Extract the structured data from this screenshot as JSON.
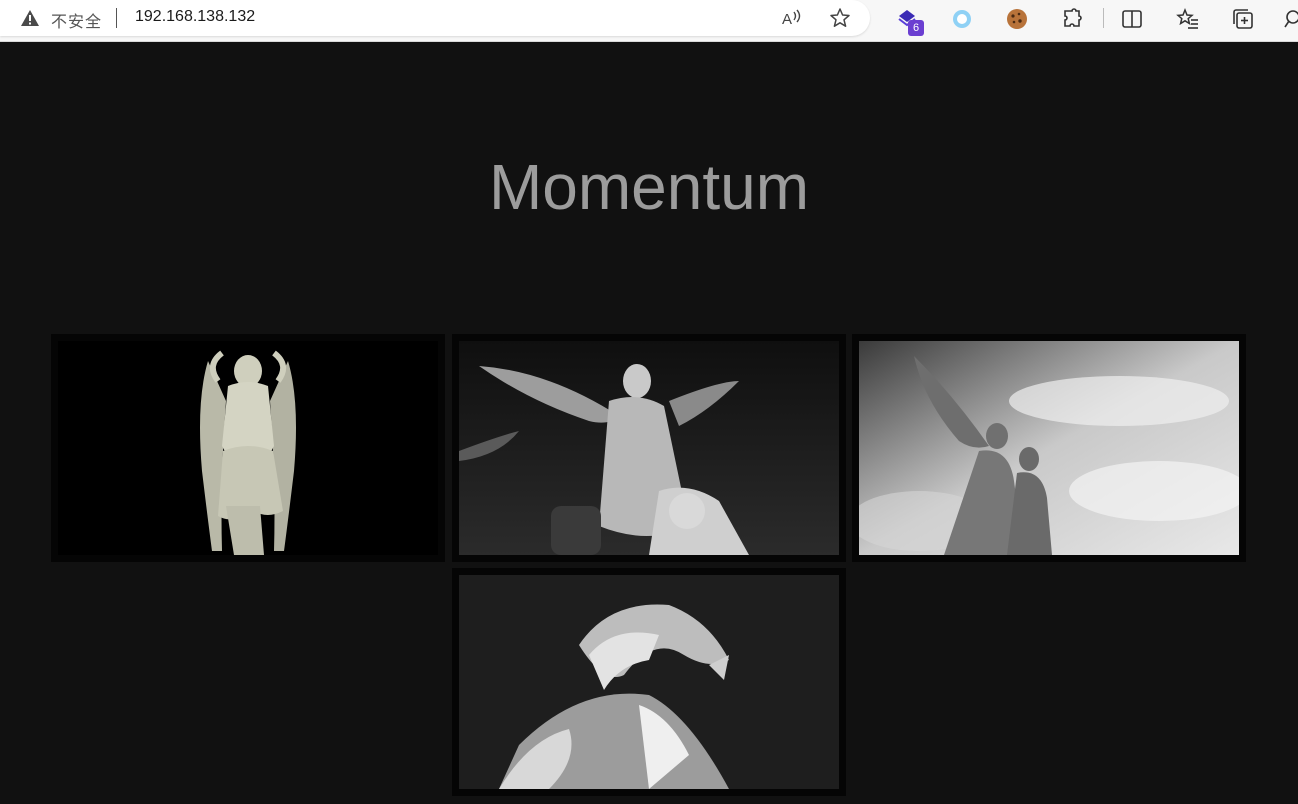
{
  "browser": {
    "security_label": "不安全",
    "url": "192.168.138.132",
    "extension_badge": "6",
    "icons": [
      "warning-icon",
      "read-aloud-icon",
      "favorite-star-icon",
      "extension-purple-icon",
      "extension-circle-icon",
      "cookie-icon",
      "extensions-puzzle-icon",
      "split-screen-icon",
      "favorites-list-icon",
      "collections-icon",
      "more-icon"
    ]
  },
  "page": {
    "title": "Momentum",
    "gallery": [
      {
        "subject": "winged statue on black background"
      },
      {
        "subject": "angel statue against dark sky"
      },
      {
        "subject": "angel statue group against cloudy sky"
      },
      {
        "subject": "statue head looking up in shadow"
      }
    ]
  }
}
